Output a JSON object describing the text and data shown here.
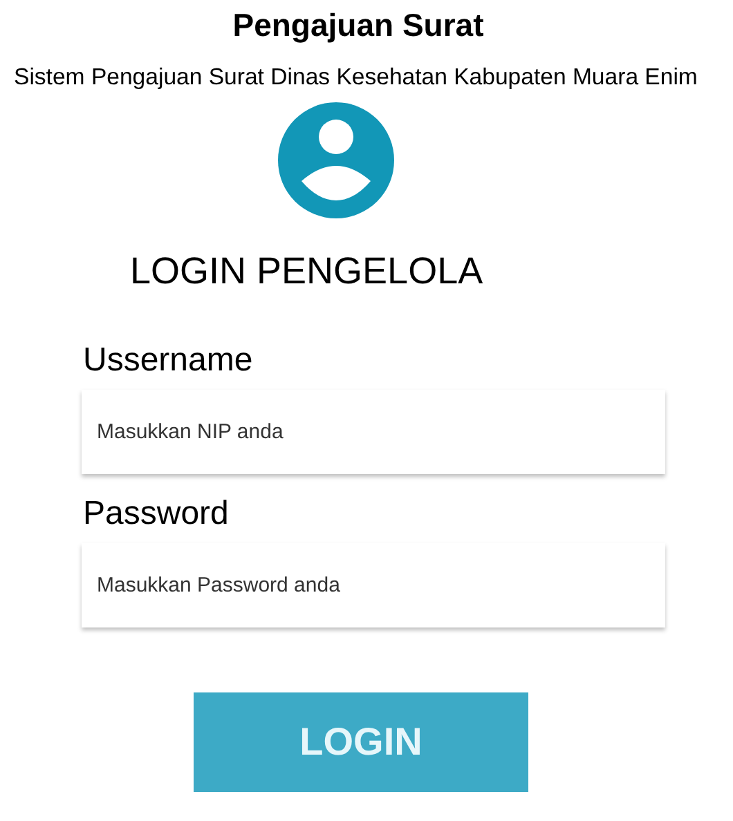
{
  "header": {
    "title": "Pengajuan Surat",
    "subtitle": "Sistem Pengajuan Surat Dinas Kesehatan Kabupaten Muara Enim"
  },
  "login": {
    "heading": "LOGIN PENGELOLA",
    "fields": [
      {
        "label": "Ussername",
        "placeholder": "Masukkan NIP anda"
      },
      {
        "label": "Password",
        "placeholder": "Masukkan Password anda"
      }
    ],
    "button": "LOGIN"
  }
}
